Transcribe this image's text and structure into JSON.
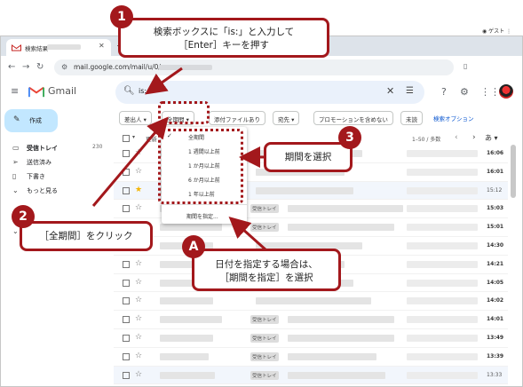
{
  "browser": {
    "tab_title": "検索結果",
    "url": "mail.google.com/mail/u/0/",
    "profile_label": "ゲスト"
  },
  "gmail": {
    "brand": "Gmail",
    "search_value": "is:",
    "compose_label": "作成",
    "sidebar": [
      {
        "icon": "inbox-icon",
        "label": "受信トレイ",
        "count": "230",
        "active": true
      },
      {
        "icon": "send-icon",
        "label": "送信済み",
        "count": ""
      },
      {
        "icon": "draft-icon",
        "label": "下書き",
        "count": ""
      },
      {
        "icon": "expand-icon",
        "label": "もっと見る",
        "count": ""
      }
    ],
    "filters": [
      {
        "label": "差出人 ▾"
      },
      {
        "label": "全期間 ▾"
      },
      {
        "label": "添付ファイルあり"
      },
      {
        "label": "宛先 ▾"
      },
      {
        "label": "プロモーションを含めない"
      },
      {
        "label": "未読"
      }
    ],
    "advanced_search": "検索オプション",
    "list_toolbar": {
      "label": "更新",
      "pagination": "1–50 / 多数",
      "sort_label": "あ ▾"
    },
    "period_menu": {
      "options": [
        {
          "label": "全期間",
          "checked": true
        },
        {
          "label": "1 週間以上前",
          "checked": false
        },
        {
          "label": "1 か月以上前",
          "checked": false
        },
        {
          "label": "6 か月以上前",
          "checked": false
        },
        {
          "label": "1 年以上前",
          "checked": false
        }
      ],
      "custom_label": "期間を指定..."
    },
    "rows": [
      {
        "time": "16:06",
        "tag": "",
        "starred": false,
        "read": false
      },
      {
        "time": "16:01",
        "tag": "",
        "starred": false,
        "read": false
      },
      {
        "time": "15:12",
        "tag": "",
        "starred": true,
        "read": true
      },
      {
        "time": "15:03",
        "tag": "受信トレイ",
        "starred": false,
        "read": false
      },
      {
        "time": "15:01",
        "tag": "受信トレイ",
        "starred": false,
        "read": false
      },
      {
        "time": "14:30",
        "tag": "",
        "starred": false,
        "read": false
      },
      {
        "time": "14:21",
        "tag": "",
        "starred": false,
        "read": false
      },
      {
        "time": "14:05",
        "tag": "",
        "starred": false,
        "read": false
      },
      {
        "time": "14:02",
        "tag": "",
        "starred": false,
        "read": false
      },
      {
        "time": "14:01",
        "tag": "受信トレイ",
        "starred": false,
        "read": false
      },
      {
        "time": "13:49",
        "tag": "受信トレイ",
        "starred": false,
        "read": false
      },
      {
        "time": "13:39",
        "tag": "受信トレイ",
        "starred": false,
        "read": false
      },
      {
        "time": "13:33",
        "tag": "受信トレイ",
        "starred": false,
        "read": true
      }
    ]
  },
  "annotations": {
    "step1": {
      "num": "1",
      "text_line1": "検索ボックスに「is:」と入力して",
      "text_line2": "［Enter］キーを押す"
    },
    "step2": {
      "num": "2",
      "text": "［全期間］をクリック"
    },
    "step3": {
      "num": "3",
      "text": "期間を選択"
    },
    "stepA": {
      "num": "A",
      "text_line1": "日付を指定する場合は、",
      "text_line2": "［期間を指定］を選択"
    }
  },
  "colors": {
    "accent": "#a3181c",
    "search_bg": "#eaf1fb",
    "compose_bg": "#c2e7ff"
  }
}
